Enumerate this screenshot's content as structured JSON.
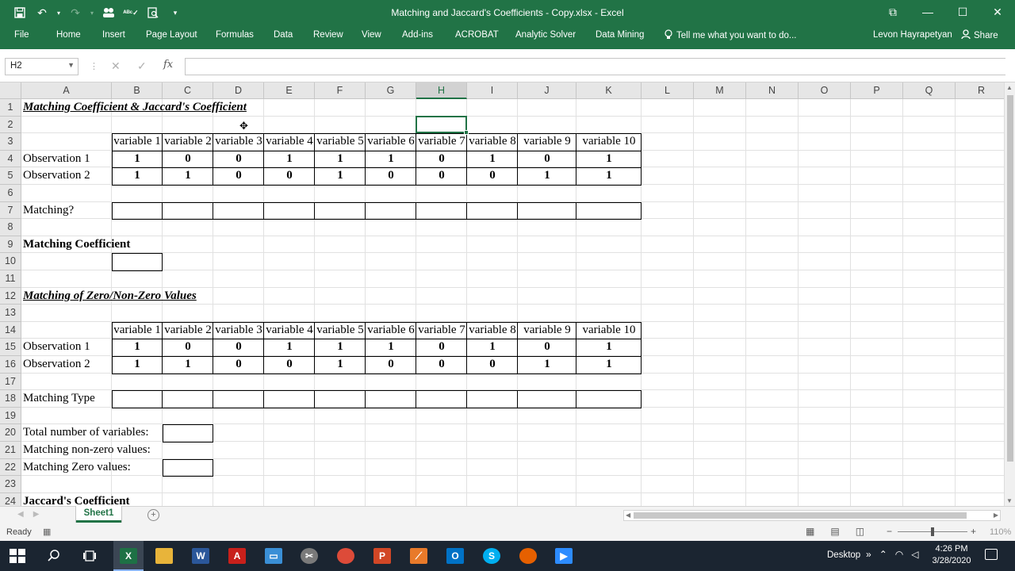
{
  "window": {
    "title": "Matching and Jaccard's Coefficients - Copy.xlsx - Excel",
    "controls": [
      "⧉",
      "—",
      "☐",
      "✕"
    ]
  },
  "quick_access": {
    "save_icon": "save-icon",
    "undo_icon": "undo-icon",
    "redo_icon": "redo-icon",
    "autofilter_icon": "people-icon",
    "spell_icon": "spellcheck-icon",
    "preview_icon": "print-preview-icon",
    "customize_icon": "customize-qat-icon"
  },
  "ribbon": {
    "tabs": [
      {
        "label": "File"
      },
      {
        "label": "Home"
      },
      {
        "label": "Insert"
      },
      {
        "label": "Page Layout"
      },
      {
        "label": "Formulas"
      },
      {
        "label": "Data"
      },
      {
        "label": "Review"
      },
      {
        "label": "View"
      },
      {
        "label": "Add-ins"
      },
      {
        "label": "ACROBAT"
      },
      {
        "label": "Analytic Solver"
      },
      {
        "label": "Data Mining"
      }
    ],
    "tell_me": "Tell me what you want to do...",
    "user": "Levon Hayrapetyan",
    "share": "Share"
  },
  "formula_bar": {
    "name_box": "H2",
    "formula": "",
    "fx": "fx"
  },
  "columns": [
    "A",
    "B",
    "C",
    "D",
    "E",
    "F",
    "G",
    "H",
    "I",
    "J",
    "K",
    "L",
    "M",
    "N",
    "O",
    "P",
    "Q",
    "R"
  ],
  "selected_column": "H",
  "rows": [
    "1",
    "2",
    "3",
    "4",
    "5",
    "6",
    "7",
    "8",
    "9",
    "10",
    "11",
    "12",
    "13",
    "14",
    "15",
    "16",
    "17",
    "18",
    "19",
    "20",
    "21",
    "22",
    "23",
    "24"
  ],
  "sheet": {
    "title1": "Matching Coefficient & Jaccard's Coefficient",
    "header_row": [
      "variable 1",
      "variable 2",
      "variable 3",
      "variable 4",
      "variable 5",
      "variable 6",
      "variable 7",
      "variable 8",
      "variable 9",
      "variable 10"
    ],
    "obs1_label": "Observation 1",
    "obs2_label": "Observation 2",
    "obs1": [
      "1",
      "0",
      "0",
      "1",
      "1",
      "1",
      "0",
      "1",
      "0",
      "1"
    ],
    "obs2": [
      "1",
      "1",
      "0",
      "0",
      "1",
      "0",
      "0",
      "0",
      "1",
      "1"
    ],
    "matching_label": "Matching?",
    "matching_coef_label": "Matching Coefficient",
    "title2": "Matching of Zero/Non-Zero Values",
    "matching_type_label": "Matching Type",
    "total_vars_label": "Total number of variables:",
    "nonzero_label": "Matching non-zero values:",
    "zero_label": "Matching Zero values:",
    "jaccard_label": "Jaccard's Coefficient"
  },
  "sheet_tabs": [
    {
      "label": "Sheet1"
    }
  ],
  "status": {
    "ready": "Ready",
    "zoom": "110%"
  },
  "taskbar": {
    "desktop_label": "Desktop",
    "time": "4:26 PM",
    "date": "3/28/2020"
  }
}
